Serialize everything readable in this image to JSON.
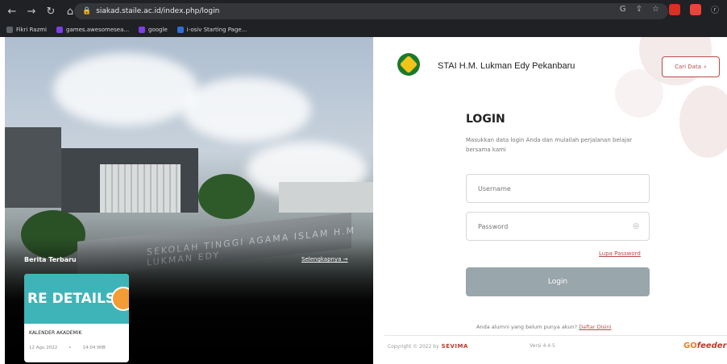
{
  "browser": {
    "url": "siakad.staile.ac.id/index.php/login",
    "bookmarks": [
      {
        "label": "Fikri Razmi",
        "color": "#5f6368"
      },
      {
        "label": "games.awesomesea...",
        "color": "#7b3fe4"
      },
      {
        "label": "google",
        "color": "#7b3fe4"
      },
      {
        "label": "i-osiv Starting Page...",
        "color": "#2f6fd6"
      }
    ]
  },
  "hero": {
    "wall_text": "SEKOLAH TINGGI AGAMA ISLAM H.M LUKMAN EDY",
    "berita_title": "Berita Terbaru",
    "selengkapnya": "Selengkapnya →",
    "news": {
      "image_text": "RE DETAILS",
      "title": "KALENDER AKADEMIK",
      "date": "12 Agu 2022",
      "separator": "•",
      "time": "14:04 WIB"
    }
  },
  "header": {
    "institution": "STAI H.M. Lukman Edy Pekanbaru",
    "cari_data": "Cari Data"
  },
  "login": {
    "title": "LOGIN",
    "subtitle": "Masukkan data login Anda dan mulailah perjalanan belajar bersama kami",
    "username_placeholder": "Username",
    "password_placeholder": "Password",
    "lupa_password": "Lupa Password",
    "button": "Login",
    "alumni_text": "Anda alumni yang belum punya akun?",
    "daftar": "Daftar Disini"
  },
  "footer": {
    "copyright": "Copyright © 2022 by",
    "brand": "SEVIMA",
    "versi": "Versi 4.4.5",
    "gofeeder_go": "GO",
    "gofeeder_rest": "feeder"
  },
  "colors": {
    "accent": "#b84a4a",
    "login_button": "#99a6ac",
    "news_teal": "#3fb4b8"
  }
}
